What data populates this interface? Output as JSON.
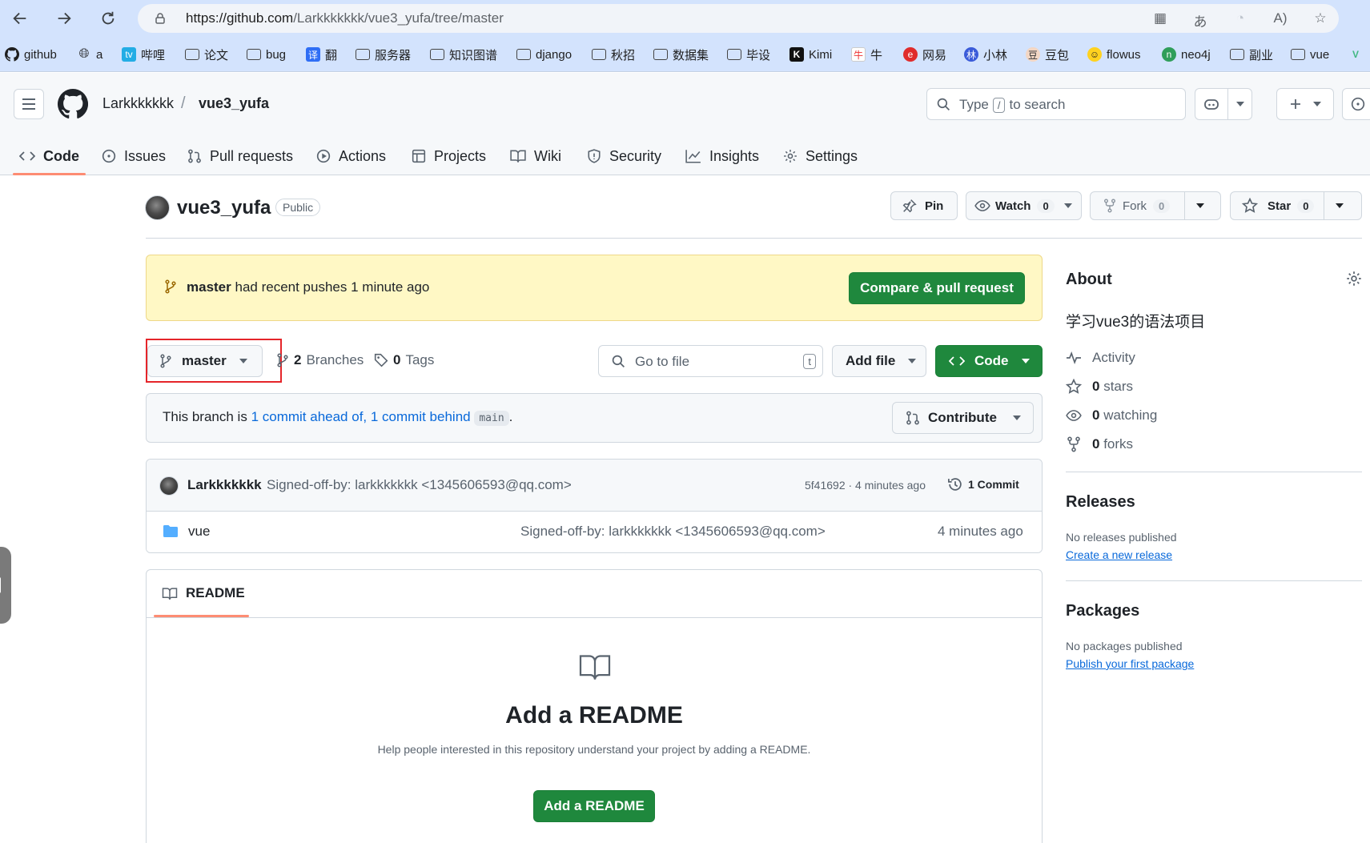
{
  "browser": {
    "url_host": "https://github.com",
    "url_path": "/Larkkkkkkk/vue3_yufa/tree/master",
    "bookmarks": [
      {
        "label": "github",
        "icon": "github-icon"
      },
      {
        "label": "a",
        "icon": "globe-icon"
      },
      {
        "label": "哔哩",
        "icon": "bilibili-icon"
      },
      {
        "label": "论文",
        "icon": "folder-icon"
      },
      {
        "label": "bug",
        "icon": "folder-icon"
      },
      {
        "label": "翻",
        "icon": "translate-icon"
      },
      {
        "label": "服务器",
        "icon": "folder-icon"
      },
      {
        "label": "知识图谱",
        "icon": "folder-icon"
      },
      {
        "label": "django",
        "icon": "folder-icon"
      },
      {
        "label": "秋招",
        "icon": "folder-icon"
      },
      {
        "label": "数据集",
        "icon": "folder-icon"
      },
      {
        "label": "毕设",
        "icon": "folder-icon"
      },
      {
        "label": "Kimi",
        "icon": "kimi-icon"
      },
      {
        "label": "牛",
        "icon": "niuke-icon"
      },
      {
        "label": "网易",
        "icon": "netease-icon"
      },
      {
        "label": "小林",
        "icon": "xiaolin-icon"
      },
      {
        "label": "豆包",
        "icon": "doubao-icon"
      },
      {
        "label": "flowus",
        "icon": "flowus-icon"
      },
      {
        "label": "neo4j",
        "icon": "neo4j-icon"
      },
      {
        "label": "副业",
        "icon": "folder-icon"
      },
      {
        "label": "vue",
        "icon": "folder-icon"
      }
    ]
  },
  "header": {
    "owner": "Larkkkkkkk",
    "separator": "/",
    "repo": "vue3_yufa",
    "search_prefix": "Type",
    "search_key": "/",
    "search_suffix": "to search"
  },
  "tabs": [
    {
      "label": "Code",
      "icon": "code-icon"
    },
    {
      "label": "Issues",
      "icon": "issue-icon"
    },
    {
      "label": "Pull requests",
      "icon": "pull-request-icon"
    },
    {
      "label": "Actions",
      "icon": "play-icon"
    },
    {
      "label": "Projects",
      "icon": "table-icon"
    },
    {
      "label": "Wiki",
      "icon": "book-icon"
    },
    {
      "label": "Security",
      "icon": "shield-icon"
    },
    {
      "label": "Insights",
      "icon": "graph-icon"
    },
    {
      "label": "Settings",
      "icon": "gear-icon"
    }
  ],
  "repo": {
    "name": "vue3_yufa",
    "visibility": "Public",
    "pin_label": "Pin",
    "watch_label": "Watch",
    "watch_count": "0",
    "fork_label": "Fork",
    "fork_count": "0",
    "star_label": "Star",
    "star_count": "0"
  },
  "banner": {
    "branch": "master",
    "text": "had recent pushes 1 minute ago",
    "button": "Compare & pull request"
  },
  "branch_bar": {
    "current_branch": "master",
    "branches_count": "2",
    "branches_label": "Branches",
    "tags_count": "0",
    "tags_label": "Tags",
    "goto_placeholder": "Go to file",
    "goto_key": "t",
    "add_file": "Add file",
    "code_button": "Code"
  },
  "ahead_behind": {
    "prefix": "This branch is",
    "ahead": "1 commit ahead of,",
    "behind": "1 commit behind",
    "base": "main",
    "suffix": ".",
    "contribute": "Contribute"
  },
  "latest_commit": {
    "author": "Larkkkkkkk",
    "message": "Signed-off-by: larkkkkkkk <1345606593@qq.com>",
    "sha_time": "5f41692 · 4 minutes ago",
    "commits": "1 Commit"
  },
  "files": [
    {
      "name": "vue",
      "type": "folder",
      "message": "Signed-off-by: larkkkkkkk <1345606593@qq.com>",
      "time": "4 minutes ago"
    }
  ],
  "readme": {
    "tab": "README",
    "title": "Add a README",
    "description": "Help people interested in this repository understand your project by adding a README.",
    "button": "Add a README"
  },
  "about": {
    "heading": "About",
    "description": "学习vue3的语法项目",
    "activity": "Activity",
    "stars_count": "0",
    "stars_label": "stars",
    "watching_count": "0",
    "watching_label": "watching",
    "forks_count": "0",
    "forks_label": "forks"
  },
  "releases": {
    "heading": "Releases",
    "empty": "No releases published",
    "link": "Create a new release"
  },
  "packages": {
    "heading": "Packages",
    "empty": "No packages published",
    "link": "Publish your first package"
  },
  "colors": {
    "accent_green": "#1f883d",
    "link_blue": "#0969da",
    "tab_underline": "#fd8c73",
    "banner_yellow": "#fff8c5",
    "highlight_red": "#e5252a"
  }
}
